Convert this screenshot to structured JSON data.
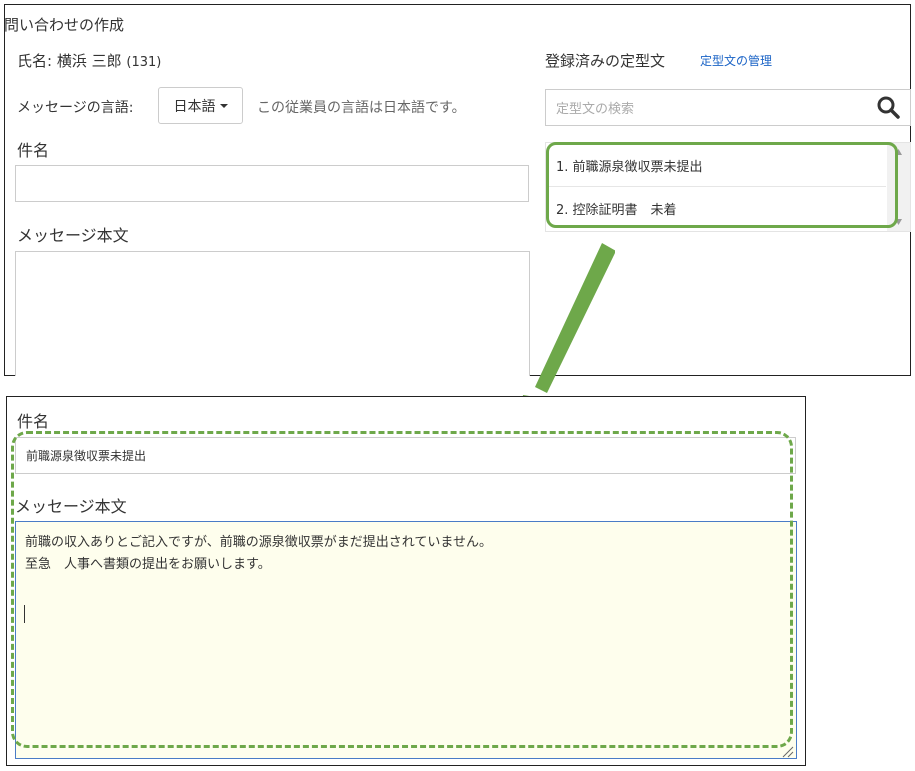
{
  "top": {
    "title": "問い合わせの作成",
    "employee_prefix": "氏名: 横浜 三郎",
    "employee_id": "(131)",
    "lang_label": "メッセージの言語:",
    "lang_value": "日本語",
    "lang_note": "この従業員の言語は日本語です。",
    "subject_label": "件名",
    "body_label": "メッセージ本文",
    "templates_label": "登録済みの定型文",
    "templates_link": "定型文の管理",
    "search_placeholder": "定型文の検索",
    "templates": [
      "1. 前職源泉徴収票未提出",
      "2. 控除証明書　未着"
    ]
  },
  "bottom": {
    "subject_label": "件名",
    "subject_value": "前職源泉徴収票未提出",
    "body_label": "メッセージ本文",
    "body_lines": [
      "前職の収入ありとご記入ですが、前職の源泉徴収票がまだ提出されていません。",
      "至急　人事へ書類の提出をお願いします。"
    ]
  },
  "colors": {
    "highlight": "#6ea84a",
    "link": "#1a63c6",
    "textarea_bg": "#fefeed",
    "focus_border": "#4a7cc6"
  },
  "icons": {
    "search": "search-icon",
    "dropdown": "caret-down-icon",
    "resize": "resize-grip-icon"
  }
}
